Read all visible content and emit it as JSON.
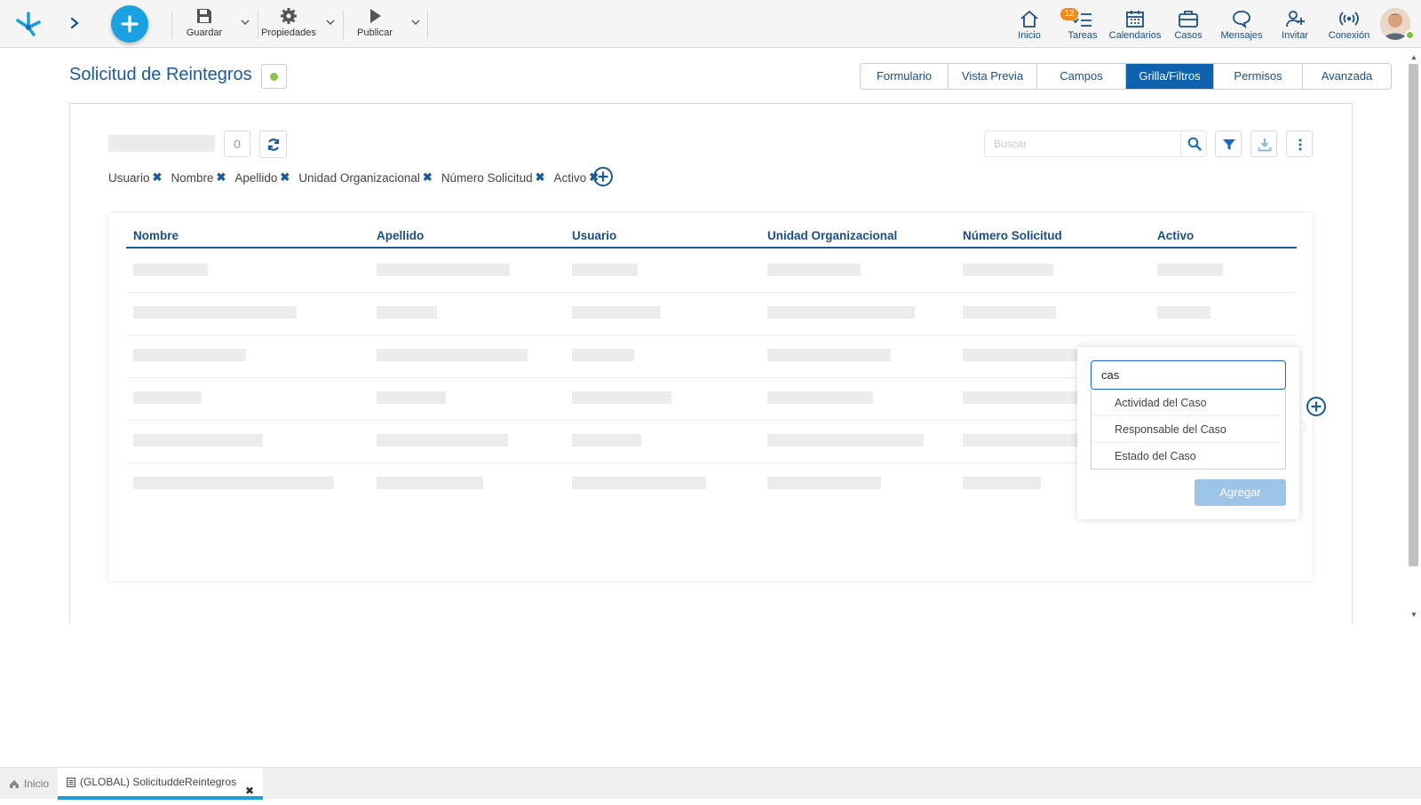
{
  "toolbar": {
    "guardar": "Guardar",
    "propiedades": "Propiedades",
    "publicar": "Publicar"
  },
  "nav": {
    "inicio": "Inicio",
    "tareas": "Tareas",
    "tareas_badge": "12",
    "calendarios": "Calendarios",
    "casos": "Casos",
    "mensajes": "Mensajes",
    "invitar": "Invitar",
    "conexion": "Conexión"
  },
  "page": {
    "title": "Solicitud de Reintegros"
  },
  "tabs": [
    {
      "label": "Formulario"
    },
    {
      "label": "Vista Previa"
    },
    {
      "label": "Campos"
    },
    {
      "label": "Grilla/Filtros"
    },
    {
      "label": "Permisos"
    },
    {
      "label": "Avanzada"
    }
  ],
  "panel": {
    "count": "0",
    "search_placeholder": "Buscar"
  },
  "chips": [
    {
      "label": "Usuario"
    },
    {
      "label": "Nombre"
    },
    {
      "label": "Apellido"
    },
    {
      "label": "Unidad Organizacional"
    },
    {
      "label": "Número Solicitud"
    },
    {
      "label": "Activo"
    }
  ],
  "grid": {
    "columns": [
      "Nombre",
      "Apellido",
      "Usuario",
      "Unidad Organizacional",
      "Número Solicitud",
      "Activo"
    ]
  },
  "popover": {
    "input_value": "cas",
    "options": [
      "Actividad del Caso",
      "Responsable del Caso",
      "Estado del Caso"
    ],
    "add_button": "Agregar"
  },
  "taskbar": {
    "home": "Inicio",
    "doc_tab": "(GLOBAL) SolicituddeReintegros"
  },
  "colors": {
    "primary": "#1a5a9a",
    "active_tab": "#0d61ad",
    "add_button": "#1aa1e2",
    "badge": "#f08a1c",
    "status": "#8bc34a"
  }
}
